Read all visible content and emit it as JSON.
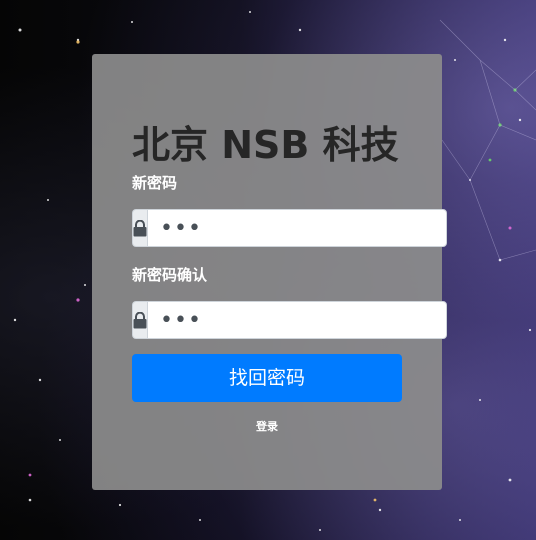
{
  "form": {
    "title": "北京 NSB 科技",
    "new_password_label": "新密码",
    "new_password_value": "abc",
    "confirm_password_label": "新密码确认",
    "confirm_password_value": "abc",
    "submit_label": "找回密码",
    "login_link": "登录"
  },
  "icons": {
    "lock": "lock-icon"
  },
  "colors": {
    "card_bg": "#8c8c8c",
    "title": "#262626",
    "label": "#ffffff",
    "primary": "#007bff",
    "addon_bg": "#e9ecef"
  }
}
